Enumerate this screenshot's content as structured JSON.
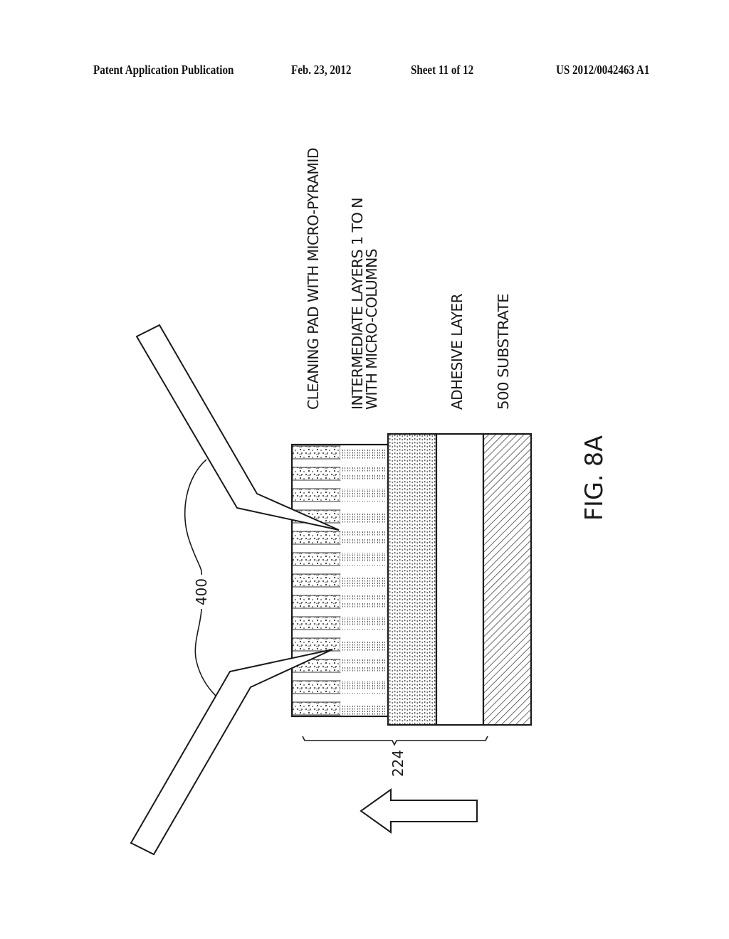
{
  "header": {
    "title": "Patent Application Publication",
    "date": "Feb. 23, 2012",
    "sheet": "Sheet 11 of 12",
    "number": "US 2012/0042463 A1"
  },
  "figure": {
    "caption": "FIG. 8A",
    "layer_labels": {
      "cleaning_pad": "CLEANING PAD WITH MICRO-PYRAMID",
      "intermediate_line1": "INTERMEDIATE LAYERS 1 TO N",
      "intermediate_line2": "WITH MICRO-COLUMNS",
      "adhesive": "ADHESIVE LAYER",
      "substrate": "500  SUBSTRATE"
    },
    "reference_numerals": {
      "probes": "400",
      "pad_stack": "224"
    },
    "micro_column_rows": 13,
    "motion_direction": "left",
    "colors": {
      "ink": "#1a1a1a",
      "paper": "#ffffff",
      "texture": "#6e6e6e"
    }
  }
}
